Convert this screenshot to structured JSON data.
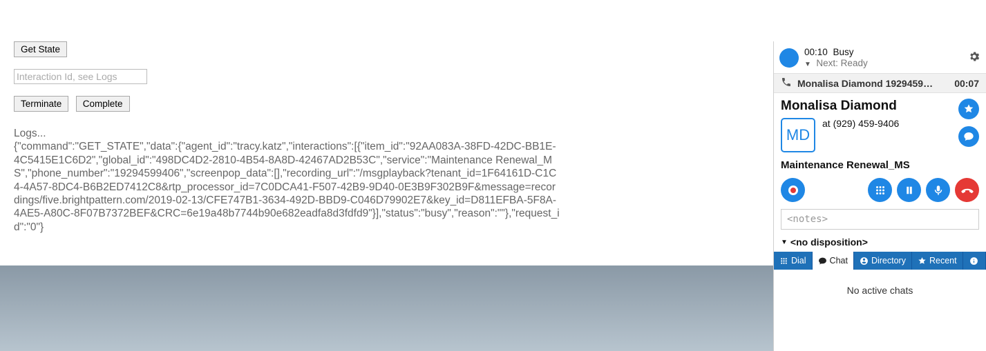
{
  "left": {
    "get_state_label": "Get State",
    "interaction_placeholder": "Interaction Id, see Logs",
    "terminate_label": "Terminate",
    "complete_label": "Complete",
    "logs_label": "Logs...",
    "logs_body": "{\"command\":\"GET_STATE\",\"data\":{\"agent_id\":\"tracy.katz\",\"interactions\":[{\"item_id\":\"92AA083A-38FD-42DC-BB1E-4C5415E1C6D2\",\"global_id\":\"498DC4D2-2810-4B54-8A8D-42467AD2B53C\",\"service\":\"Maintenance Renewal_MS\",\"phone_number\":\"19294599406\",\"screenpop_data\":[],\"recording_url\":\"/msgplayback?tenant_id=1F64161D-C1C4-4A57-8DC4-B6B2ED7412C8&rtp_processor_id=7C0DCA41-F507-42B9-9D40-0E3B9F302B9F&message=recordings/five.brightpattern.com/2019-02-13/CFE747B1-3634-492D-BBD9-C046D79902E7&key_id=D811EFBA-5F8A-4AE5-A80C-8F07B7372BEF&CRC=6e19a48b7744b90e682eadfa8d3fdfd9\"}],\"status\":\"busy\",\"reason\":\"\"},\"request_id\":\"0\"}"
  },
  "agent": {
    "status_timer": "00:10",
    "status_label": "Busy",
    "next_label": "Next: Ready"
  },
  "call": {
    "header_name": "Monalisa Diamond 1929459…",
    "header_timer": "00:07"
  },
  "contact": {
    "name": "Monalisa Diamond",
    "initials": "MD",
    "phone_line": "at (929) 459-9406"
  },
  "service": {
    "name": "Maintenance Renewal_MS"
  },
  "notes": {
    "placeholder": "<notes>"
  },
  "disposition": {
    "label": "<no disposition>"
  },
  "tabs": {
    "dial": "Dial",
    "chat": "Chat",
    "directory": "Directory",
    "recent": "Recent"
  },
  "chat": {
    "empty": "No active chats"
  }
}
